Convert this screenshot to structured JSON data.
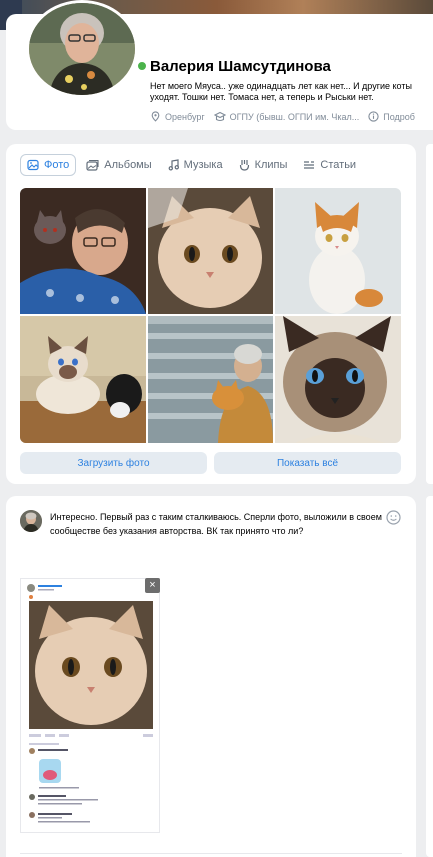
{
  "profile": {
    "name": "Валерия Шамсутдинова",
    "status": "Нет моего Мяуса.. уже одинадцать лет как нет... И другие коты уходят. Тошки нет. Томаса нет, а теперь и Рыськи нет.",
    "city": "Оренбург",
    "education": "ОГПУ (бывш. ОГПИ им. Чкал...",
    "details_label": "Подроб",
    "online": true
  },
  "photos": {
    "tabs": [
      {
        "label": "Фото",
        "icon": "photo-icon",
        "active": true
      },
      {
        "label": "Альбомы",
        "icon": "albums-icon",
        "active": false
      },
      {
        "label": "Музыка",
        "icon": "music-icon",
        "active": false
      },
      {
        "label": "Клипы",
        "icon": "clips-icon",
        "active": false
      },
      {
        "label": "Статьи",
        "icon": "articles-icon",
        "active": false
      }
    ],
    "upload_label": "Загрузить фото",
    "show_all_label": "Показать всё"
  },
  "post": {
    "text": "Интересно. Первый раз с таким сталкиваюсь. Сперли фото, выложили в своем сообществе без указания авторства. ВК так принято что ли?",
    "close_glyph": "×"
  },
  "colors": {
    "accent": "#2d81e0",
    "background": "#edeef0",
    "online": "#4bb34b",
    "secondary_text": "#818c99",
    "button_bg": "#e5ebf1"
  }
}
